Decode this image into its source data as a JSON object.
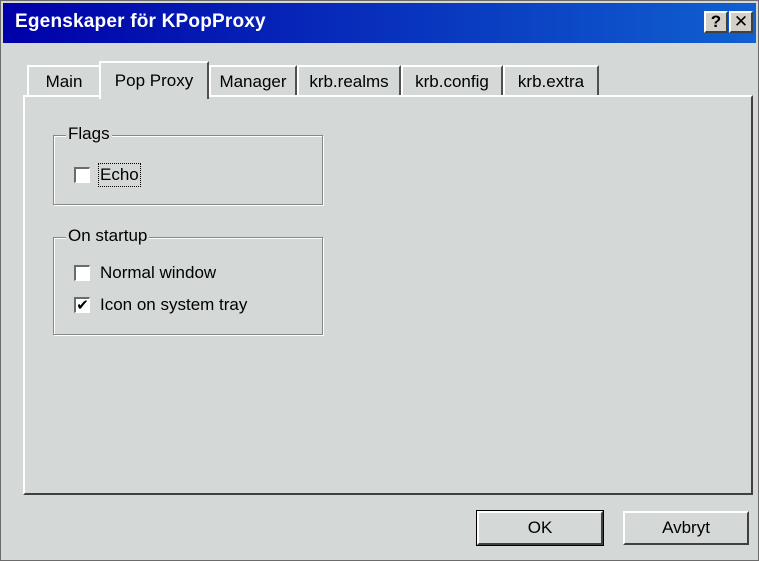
{
  "window": {
    "title": "Egenskaper för KPopProxy",
    "help_label": "?",
    "close_label": "✕"
  },
  "tabs": [
    {
      "label": "Main",
      "active": false
    },
    {
      "label": "Pop Proxy",
      "active": true
    },
    {
      "label": "Manager",
      "active": false
    },
    {
      "label": "krb.realms",
      "active": false
    },
    {
      "label": "krb.config",
      "active": false
    },
    {
      "label": "krb.extra",
      "active": false
    }
  ],
  "groups": {
    "flags": {
      "label": "Flags",
      "options": [
        {
          "label": "Echo",
          "checked": false,
          "focused": true
        }
      ]
    },
    "on_startup": {
      "label": "On startup",
      "options": [
        {
          "label": "Normal window",
          "checked": false
        },
        {
          "label": "Icon on system tray",
          "checked": true
        }
      ]
    }
  },
  "buttons": {
    "ok_label": "OK",
    "cancel_label": "Avbryt"
  },
  "checkmark": "✔"
}
